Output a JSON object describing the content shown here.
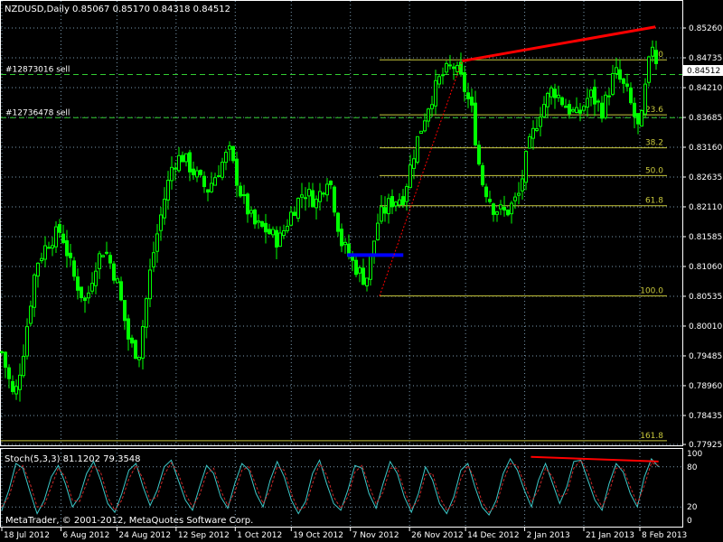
{
  "chart_data": [
    {
      "type": "candlestick",
      "title": "NZDUSD,Daily",
      "ohlc_text": "0.85067 0.85170 0.84318 0.84512",
      "price_ticks": [
        "0.85260",
        "0.84735",
        "0.84210",
        "0.83685",
        "0.83160",
        "0.82635",
        "0.82110",
        "0.81585",
        "0.81060",
        "0.80535",
        "0.80010",
        "0.79485",
        "0.78960",
        "0.78435",
        "0.77925"
      ],
      "ylim": [
        0.77925,
        0.8526
      ],
      "current_price": "0.84512",
      "date_ticks": [
        "18 Jul 2012",
        "6 Aug 2012",
        "24 Aug 2012",
        "12 Sep 2012",
        "1 Oct 2012",
        "19 Oct 2012",
        "7 Nov 2012",
        "26 Nov 2012",
        "14 Dec 2012",
        "2 Jan 2013",
        "21 Jan 2013",
        "8 Feb 2013"
      ],
      "orders": [
        {
          "label": "#12873016 sell",
          "price": 0.8444
        },
        {
          "label": "#12736478 sell",
          "price": 0.8368
        }
      ],
      "fibonacci": [
        {
          "label": "0.0",
          "price": 0.847
        },
        {
          "label": "23.6",
          "price": 0.8373
        },
        {
          "label": "38.2",
          "price": 0.8315
        },
        {
          "label": "50.0",
          "price": 0.8266
        },
        {
          "label": "61.8",
          "price": 0.8213
        },
        {
          "label": "100.0",
          "price": 0.8054
        },
        {
          "label": "161.8",
          "price": 0.7799
        }
      ],
      "trendline": {
        "from": {
          "date": "13 Dec 2012",
          "price": 0.8468
        },
        "to": {
          "date": "13 Feb 2013",
          "price": 0.8528
        }
      },
      "support_line": {
        "from": {
          "date": "6 Nov 2012",
          "price": 0.8126
        },
        "to": {
          "date": "24 Nov 2012",
          "price": 0.8126
        }
      },
      "close_path": [
        [
          "18 Jul 2012",
          0.7955
        ],
        [
          "22 Jul 2012",
          0.787
        ],
        [
          "25 Jul 2012",
          0.796
        ],
        [
          "29 Jul 2012",
          0.811
        ],
        [
          "2 Aug 2012",
          0.815
        ],
        [
          "6 Aug 2012",
          0.817
        ],
        [
          "10 Aug 2012",
          0.809
        ],
        [
          "14 Aug 2012",
          0.804
        ],
        [
          "17 Aug 2012",
          0.811
        ],
        [
          "20 Aug 2012",
          0.814
        ],
        [
          "24 Aug 2012",
          0.808
        ],
        [
          "28 Aug 2012",
          0.797
        ],
        [
          "31 Aug 2012",
          0.795
        ],
        [
          "4 Sep 2012",
          0.811
        ],
        [
          "8 Sep 2012",
          0.822
        ],
        [
          "11 Sep 2012",
          0.829
        ],
        [
          "14 Sep 2012",
          0.83
        ],
        [
          "18 Sep 2012",
          0.827
        ],
        [
          "22 Sep 2012",
          0.824
        ],
        [
          "26 Sep 2012",
          0.828
        ],
        [
          "29 Sep 2012",
          0.831
        ],
        [
          "3 Oct 2012",
          0.823
        ],
        [
          "7 Oct 2012",
          0.818
        ],
        [
          "11 Oct 2012",
          0.817
        ],
        [
          "15 Oct 2012",
          0.815
        ],
        [
          "19 Oct 2012",
          0.82
        ],
        [
          "23 Oct 2012",
          0.824
        ],
        [
          "27 Oct 2012",
          0.822
        ],
        [
          "31 Oct 2012",
          0.827
        ],
        [
          "4 Nov 2012",
          0.815
        ],
        [
          "8 Nov 2012",
          0.811
        ],
        [
          "12 Nov 2012",
          0.808
        ],
        [
          "16 Nov 2012",
          0.819
        ],
        [
          "20 Nov 2012",
          0.822
        ],
        [
          "24 Nov 2012",
          0.823
        ],
        [
          "28 Nov 2012",
          0.832
        ],
        [
          "2 Dec 2012",
          0.839
        ],
        [
          "6 Dec 2012",
          0.844
        ],
        [
          "10 Dec 2012",
          0.846
        ],
        [
          "13 Dec 2012",
          0.843
        ],
        [
          "16 Dec 2012",
          0.838
        ],
        [
          "19 Dec 2012",
          0.826
        ],
        [
          "23 Dec 2012",
          0.821
        ],
        [
          "27 Dec 2012",
          0.82
        ],
        [
          "31 Dec 2012",
          0.823
        ],
        [
          "3 Jan 2013",
          0.831
        ],
        [
          "7 Jan 2013",
          0.838
        ],
        [
          "11 Jan 2013",
          0.842
        ],
        [
          "15 Jan 2013",
          0.839
        ],
        [
          "19 Jan 2013",
          0.837
        ],
        [
          "23 Jan 2013",
          0.841
        ],
        [
          "27 Jan 2013",
          0.838
        ],
        [
          "31 Jan 2013",
          0.845
        ],
        [
          "4 Feb 2013",
          0.841
        ],
        [
          "8 Feb 2013",
          0.834
        ],
        [
          "10 Feb 2013",
          0.843
        ],
        [
          "12 Feb 2013",
          0.85
        ],
        [
          "14 Feb 2013",
          0.8451
        ]
      ]
    },
    {
      "type": "line",
      "title": "Stoch(5,3,3) 81.1202 79.3548",
      "ylim": [
        0,
        100
      ],
      "level_ticks": [
        "100",
        "80",
        "20",
        "0"
      ],
      "series": [
        {
          "name": "",
          "color": "#3cc8c8",
          "values": [
            15,
            45,
            85,
            78,
            42,
            10,
            30,
            65,
            82,
            55,
            20,
            35,
            70,
            88,
            60,
            25,
            12,
            40,
            75,
            85,
            50,
            22,
            45,
            80,
            90,
            60,
            30,
            15,
            50,
            82,
            70,
            35,
            18,
            55,
            85,
            75,
            40,
            20,
            60,
            88,
            65,
            30,
            10,
            28,
            70,
            90,
            55,
            25,
            15,
            45,
            82,
            78,
            40,
            18,
            55,
            88,
            70,
            35,
            12,
            40,
            80,
            60,
            25,
            10,
            35,
            75,
            85,
            50,
            20,
            8,
            30,
            70,
            92,
            75,
            45,
            20,
            60,
            85,
            55,
            25,
            50,
            88,
            90,
            60,
            30,
            15,
            55,
            85,
            72,
            40,
            20,
            65,
            92,
            80
          ]
        },
        {
          "name": "",
          "color": "#c82828",
          "values": [
            20,
            35,
            70,
            82,
            55,
            20,
            22,
            50,
            78,
            65,
            30,
            28,
            55,
            82,
            72,
            35,
            15,
            30,
            62,
            82,
            62,
            30,
            35,
            68,
            86,
            70,
            40,
            20,
            38,
            70,
            78,
            45,
            22,
            42,
            75,
            80,
            52,
            25,
            45,
            80,
            75,
            40,
            15,
            20,
            55,
            85,
            68,
            35,
            18,
            35,
            72,
            82,
            52,
            25,
            42,
            78,
            78,
            45,
            18,
            30,
            68,
            70,
            35,
            15,
            25,
            62,
            82,
            62,
            28,
            12,
            22,
            58,
            85,
            82,
            55,
            28,
            45,
            78,
            65,
            35,
            40,
            78,
            90,
            72,
            40,
            20,
            42,
            78,
            78,
            50,
            25,
            52,
            86,
            82
          ]
        }
      ],
      "trendline": {
        "from": {
          "date": "4 Jan 2013",
          "value": 95
        },
        "to": {
          "date": "14 Feb 2013",
          "value": 88
        }
      }
    }
  ],
  "footer": {
    "copyright": "MetaTrader, © 2001-2012, MetaQuotes Software Corp."
  },
  "colors": {
    "bull": "#00ff00",
    "bear": "#000000",
    "fib": "#c8c83c",
    "trend": "#ff0000",
    "support": "#0000ff",
    "grid": "#7a9ab0",
    "orders": "#32cd32"
  }
}
